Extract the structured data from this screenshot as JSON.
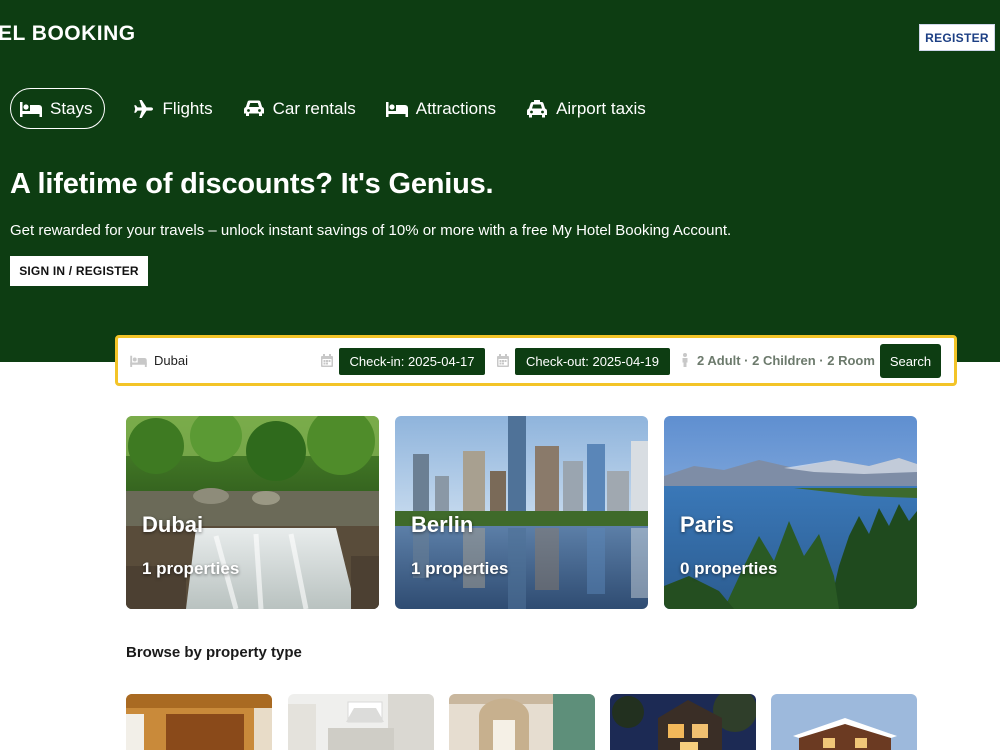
{
  "header": {
    "brand": "EL BOOKING",
    "register_label": "REGISTER"
  },
  "nav": {
    "items": [
      {
        "label": "Stays",
        "icon": "bed-icon",
        "active": true
      },
      {
        "label": "Flights",
        "icon": "plane-icon"
      },
      {
        "label": "Car rentals",
        "icon": "car-icon"
      },
      {
        "label": "Attractions",
        "icon": "bed-icon"
      },
      {
        "label": "Airport taxis",
        "icon": "taxi-icon"
      }
    ]
  },
  "hero": {
    "title": "A lifetime of discounts? It's Genius.",
    "subtitle": "Get rewarded for your travels – unlock instant savings of 10% or more with a free My Hotel Booking Account.",
    "cta_label": "SIGN IN / REGISTER"
  },
  "search": {
    "destination": "Dubai",
    "check_in": "Check-in: 2025-04-17",
    "check_out": "Check-out: 2025-04-19",
    "guests": "2 Adult · 2 Children · 2 Room",
    "button_label": "Search"
  },
  "featured": [
    {
      "city": "Dubai",
      "count": "1 properties"
    },
    {
      "city": "Berlin",
      "count": "1 properties"
    },
    {
      "city": "Paris",
      "count": "0 properties"
    }
  ],
  "property_types": {
    "title": "Browse by property type"
  },
  "colors": {
    "brand_green": "#0d3d12",
    "search_border": "#f3c428",
    "register_text": "#1c3f84"
  }
}
